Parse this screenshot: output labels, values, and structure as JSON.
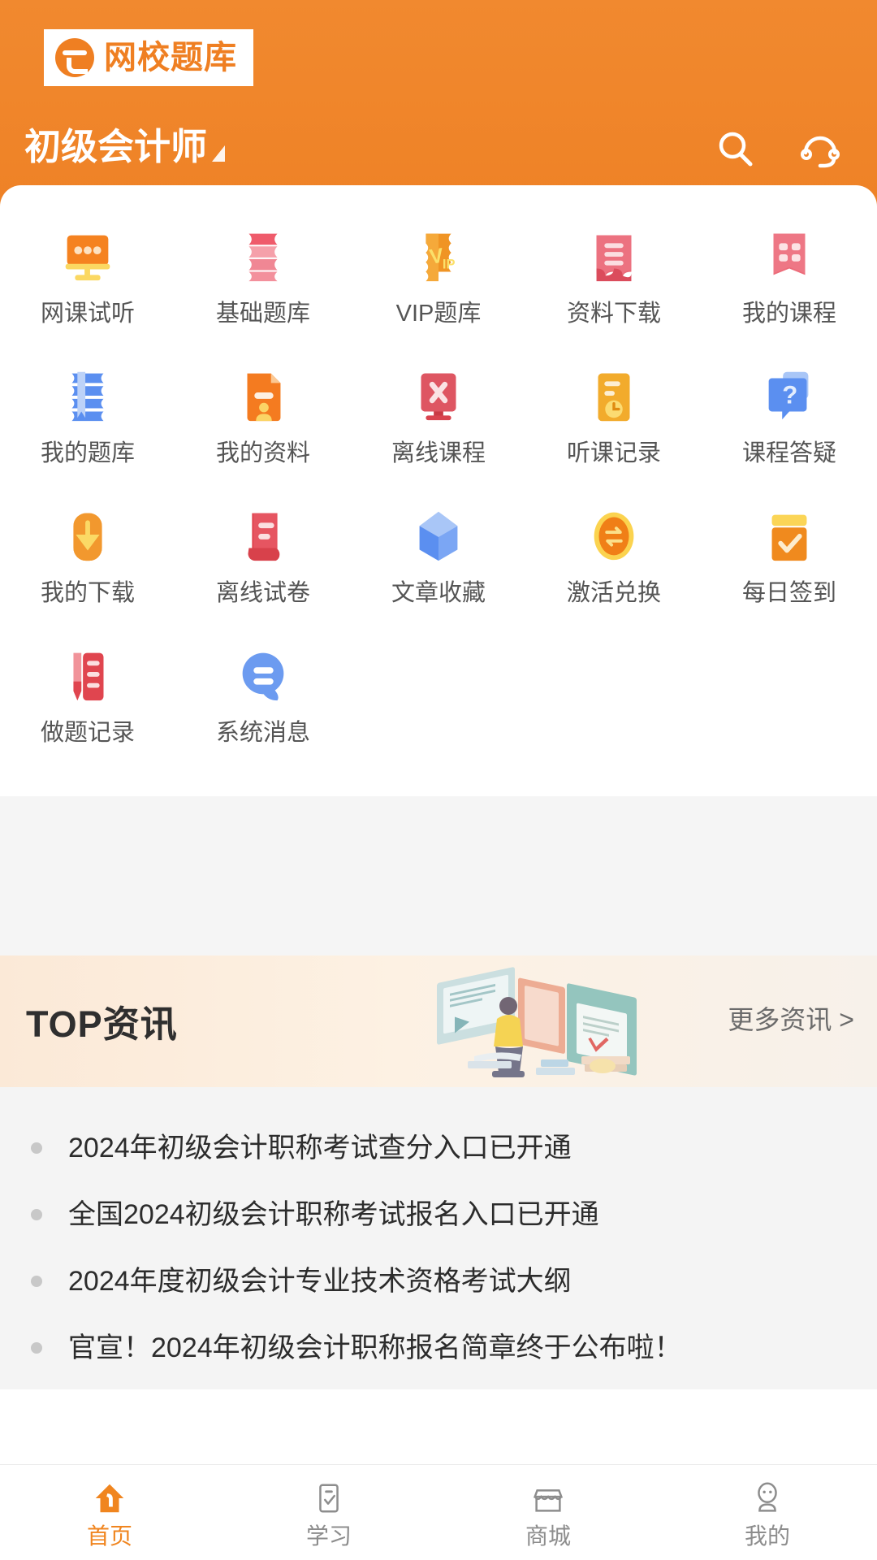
{
  "app": {
    "logo_text": "网校题库",
    "logo_icon": "cloud-logo-icon",
    "brand_orange": "#ef7f22",
    "header_bg": "#f1892f"
  },
  "header": {
    "subject": "初级会计师",
    "subject_caret_icon": "triangle-down-icon",
    "search_icon": "search-icon",
    "support_icon": "headset-icon"
  },
  "grid": {
    "items": [
      {
        "label": "网课试听",
        "icon": "monitor-dots-icon",
        "color": "#f58220"
      },
      {
        "label": "基础题库",
        "icon": "stacked-books-icon",
        "color": "#ef5b6b"
      },
      {
        "label": "VIP题库",
        "icon": "vip-book-icon",
        "color": "#f29022"
      },
      {
        "label": "资料下载",
        "icon": "document-download-icon",
        "color": "#ea6a78"
      },
      {
        "label": "我的课程",
        "icon": "open-book-icon",
        "color": "#ec6b79"
      },
      {
        "label": "我的题库",
        "icon": "bookmark-book-icon",
        "color": "#5b8ff0"
      },
      {
        "label": "我的资料",
        "icon": "file-person-icon",
        "color": "#f47b20"
      },
      {
        "label": "离线课程",
        "icon": "screen-x-icon",
        "color": "#d9444f"
      },
      {
        "label": "听课记录",
        "icon": "clock-record-icon",
        "color": "#f0a21c"
      },
      {
        "label": "课程答疑",
        "icon": "question-chat-icon",
        "color": "#5b8ff0"
      },
      {
        "label": "我的下载",
        "icon": "download-arrow-icon",
        "color": "#ef8c1e"
      },
      {
        "label": "离线试卷",
        "icon": "paper-scroll-icon",
        "color": "#e04a57"
      },
      {
        "label": "文章收藏",
        "icon": "cube-box-icon",
        "color": "#5b8ff0"
      },
      {
        "label": "激活兑换",
        "icon": "coin-exchange-icon",
        "color": "#f5a623"
      },
      {
        "label": "每日签到",
        "icon": "calendar-check-icon",
        "color": "#f08a1e"
      },
      {
        "label": "做题记录",
        "icon": "pen-notebook-icon",
        "color": "#e0454f"
      },
      {
        "label": "系统消息",
        "icon": "message-bubble-icon",
        "color": "#6c9bf0"
      }
    ]
  },
  "news_banner": {
    "title": "TOP资讯",
    "more_label": "更多资讯 >",
    "illustration_icon": "person-reading-illustration"
  },
  "news_list": {
    "bullet_icon": "bullet-dot-icon",
    "items": [
      "2024年初级会计职称考试查分入口已开通",
      "全国2024初级会计职称考试报名入口已开通",
      "2024年度初级会计专业技术资格考试大纲",
      "官宣！2024年初级会计职称报名简章终于公布啦！"
    ]
  },
  "tabbar": {
    "active_color": "#f0851f",
    "inactive_color": "#8d8d8d",
    "items": [
      {
        "label": "首页",
        "icon": "home-icon",
        "active": true
      },
      {
        "label": "学习",
        "icon": "checklist-icon",
        "active": false
      },
      {
        "label": "商城",
        "icon": "store-icon",
        "active": false
      },
      {
        "label": "我的",
        "icon": "person-icon",
        "active": false
      }
    ]
  }
}
